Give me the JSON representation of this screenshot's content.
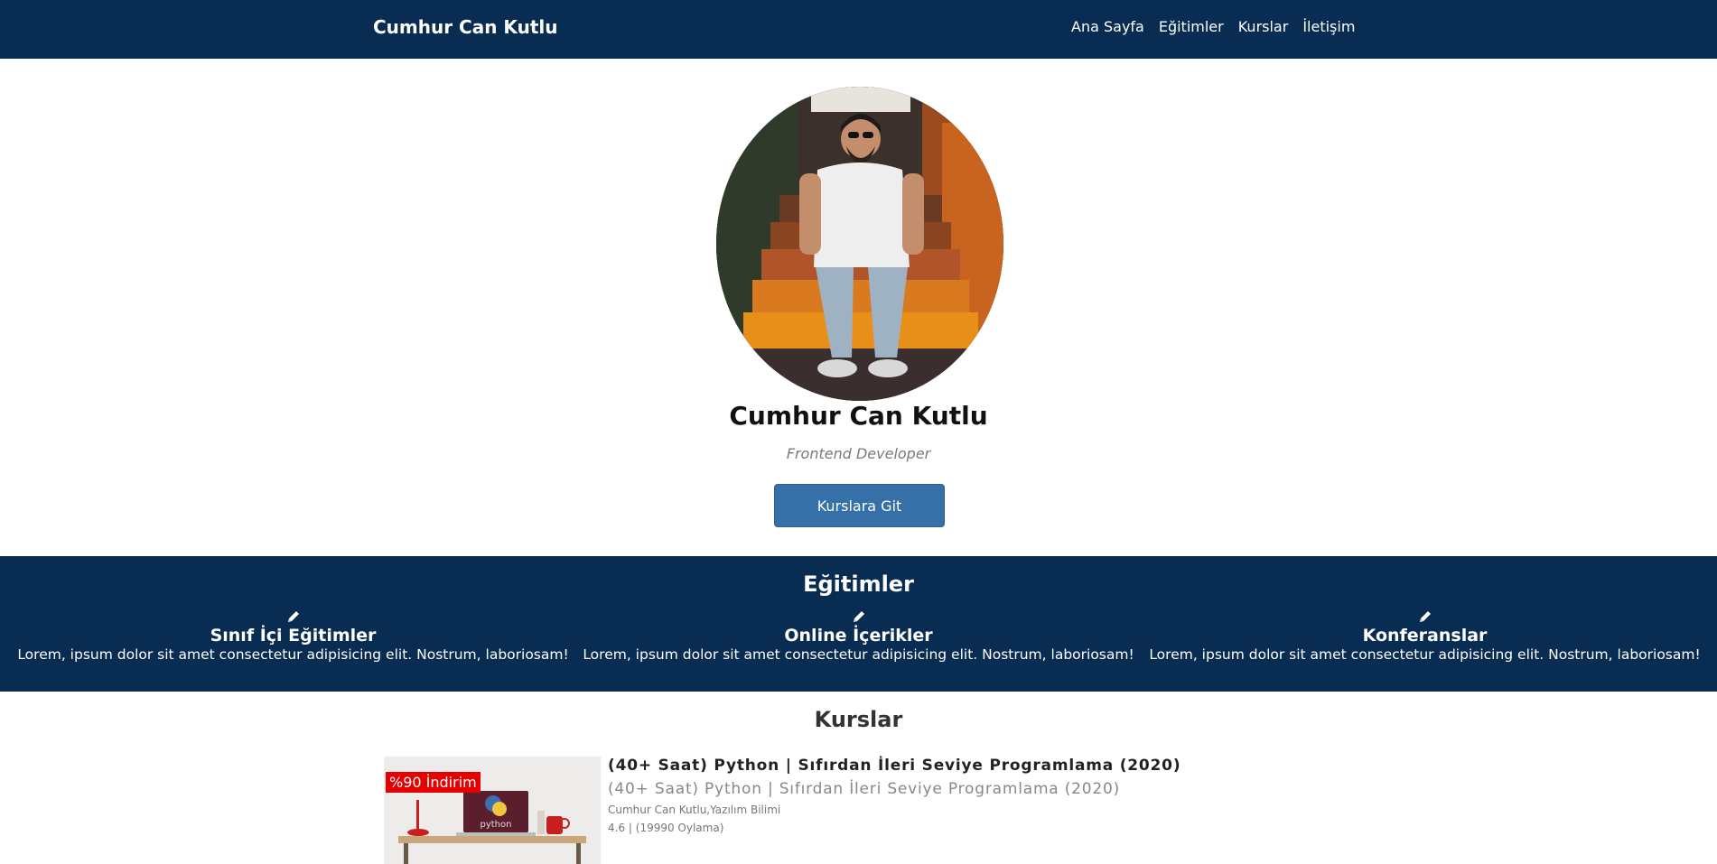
{
  "navbar": {
    "brand": "Cumhur Can Kutlu",
    "links": [
      "Ana Sayfa",
      "Eğitimler",
      "Kurslar",
      "İletişim"
    ]
  },
  "hero": {
    "name": "Cumhur Can Kutlu",
    "title": "Frontend Developer",
    "button_label": "Kurslara Git"
  },
  "education": {
    "title": "Eğitimler",
    "items": [
      {
        "icon": "pencil-icon",
        "title": "Sınıf İçi Eğitimler",
        "text": "Lorem, ipsum dolor sit amet consectetur adipisicing elit. Nostrum, laboriosam!"
      },
      {
        "icon": "pencil-icon",
        "title": "Online İçerikler",
        "text": "Lorem, ipsum dolor sit amet consectetur adipisicing elit. Nostrum, laboriosam!"
      },
      {
        "icon": "pencil-icon",
        "title": "Konferanslar",
        "text": "Lorem, ipsum dolor sit amet consectetur adipisicing elit. Nostrum, laboriosam!"
      }
    ]
  },
  "courses": {
    "title": "Kurslar",
    "items": [
      {
        "badge": "%90 İndirim",
        "title": "(40+ Saat) Python | Sıfırdan İleri Seviye Programlama (2020)",
        "subtitle": "(40+ Saat) Python | Sıfırdan İleri Seviye Programlama (2020)",
        "author": "Cumhur Can Kutlu,Yazılım Bilimi",
        "rating": "4.6 | (19990 Oylama)",
        "thumb_text": "python"
      }
    ]
  },
  "colors": {
    "navy": "#082c52",
    "button_blue": "#3570a8",
    "badge_red": "#e60000"
  }
}
